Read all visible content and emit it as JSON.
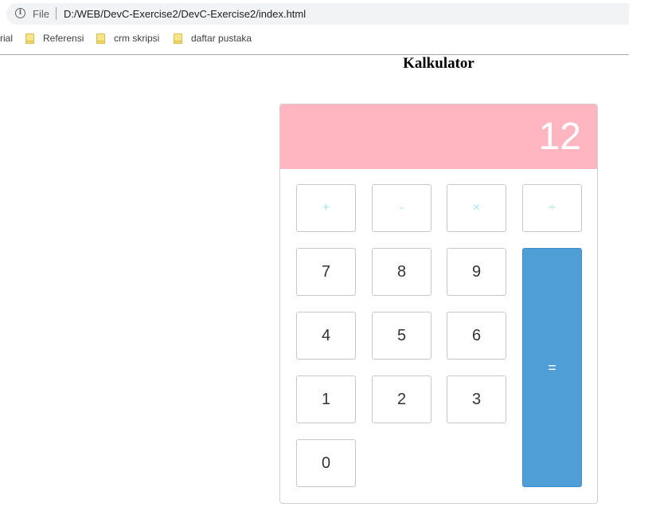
{
  "browser": {
    "file_label": "File",
    "url": "D:/WEB/DevC-Exercise2/DevC-Exercise2/index.html",
    "bookmarks": [
      {
        "label": "rial"
      },
      {
        "label": "Referensi"
      },
      {
        "label": "crm skripsi"
      },
      {
        "label": "daftar pustaka"
      }
    ]
  },
  "page": {
    "title": "Kalkulator"
  },
  "calculator": {
    "display": "12",
    "display_bg": "#ffb6c1",
    "equals_bg": "#4f9ed6",
    "operators": {
      "plus": "+",
      "minus": "-",
      "times": "×",
      "divide": "÷"
    },
    "digits": {
      "seven": "7",
      "eight": "8",
      "nine": "9",
      "four": "4",
      "five": "5",
      "six": "6",
      "one": "1",
      "two": "2",
      "three": "3",
      "zero": "0"
    },
    "equals": "="
  }
}
